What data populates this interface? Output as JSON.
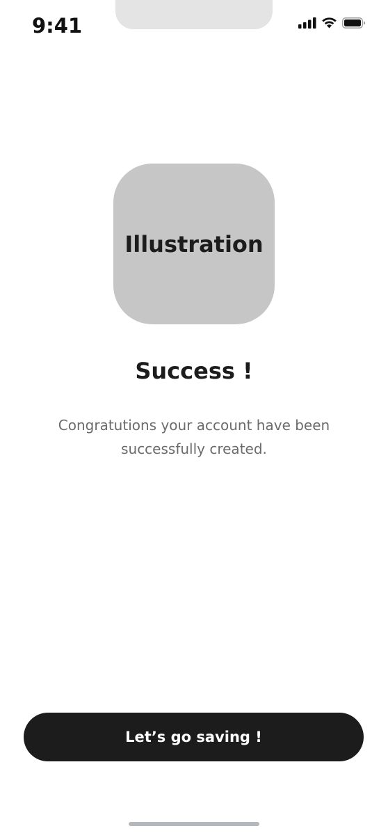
{
  "status_bar": {
    "time": "9:41",
    "icons": [
      "cellular-signal-icon",
      "wifi-icon",
      "battery-icon"
    ]
  },
  "illustration": {
    "label": "Illustration",
    "background_color": "#c6c6c6"
  },
  "content": {
    "title": "Success !",
    "message": "Congratutions your account have been successfully created."
  },
  "primary_button": {
    "label": "Let’s go saving !",
    "background_color": "#1c1c1c",
    "text_color": "#ffffff"
  }
}
